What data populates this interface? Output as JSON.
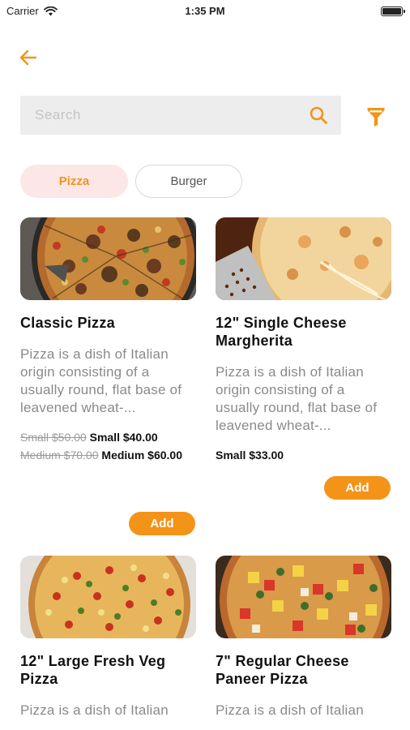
{
  "status_bar": {
    "carrier": "Carrier",
    "time": "1:35 PM"
  },
  "search": {
    "placeholder": "Search"
  },
  "categories": [
    {
      "label": "Pizza",
      "selected": true
    },
    {
      "label": "Burger",
      "selected": false
    }
  ],
  "colors": {
    "accent": "#f39419",
    "chip_selected_bg": "#fde6e6"
  },
  "products": [
    {
      "title": "Classic Pizza",
      "description": "Pizza is a dish of Italian origin consisting of a usually round, flat base of leavened wheat-...",
      "prices": [
        {
          "old": "Small $50.00",
          "new": "Small $40.00"
        },
        {
          "old": "Medium $70.00",
          "new": "Medium $60.00"
        }
      ],
      "add_label": "Add"
    },
    {
      "title": "12\" Single Cheese Margherita",
      "description": "Pizza is a dish of Italian origin consisting of a usually round, flat base of leavened wheat-...",
      "prices": [
        {
          "new": "Small $33.00"
        }
      ],
      "add_label": "Add"
    },
    {
      "title": "12\" Large Fresh Veg Pizza",
      "description": "Pizza is a dish of Italian"
    },
    {
      "title": "7\" Regular Cheese Paneer Pizza",
      "description": "Pizza is a dish of Italian"
    }
  ]
}
